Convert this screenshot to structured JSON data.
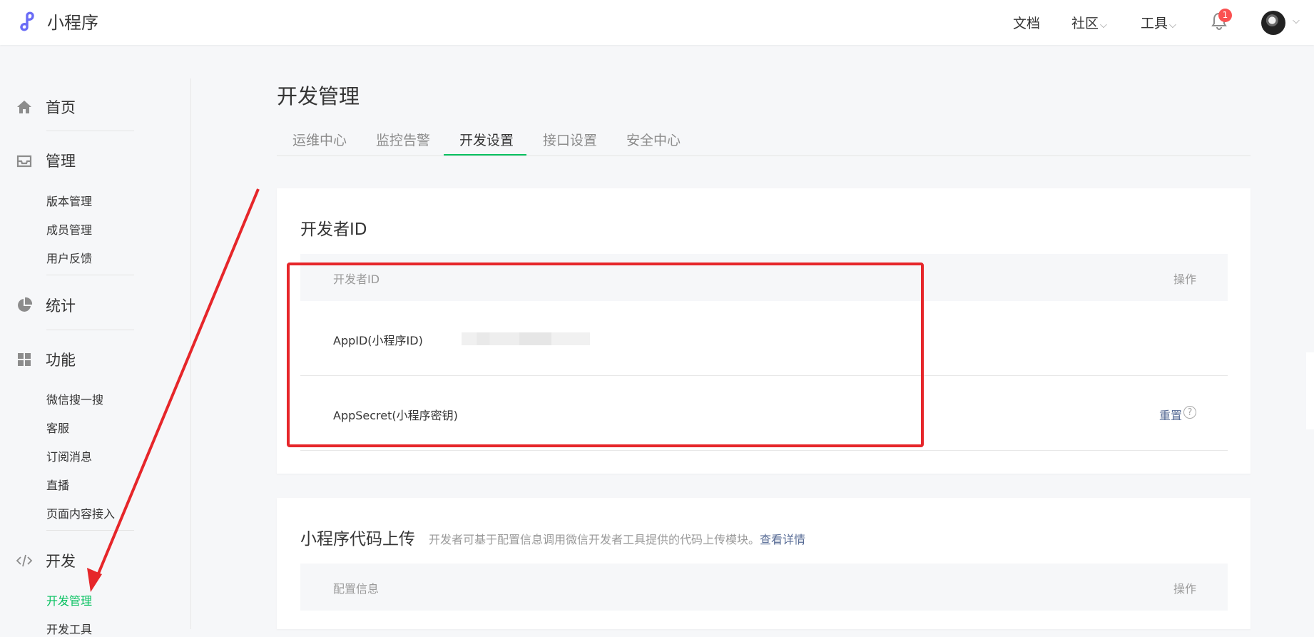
{
  "app": {
    "name": "小程序"
  },
  "topnav": {
    "docs": "文档",
    "community": "社区",
    "tools": "工具",
    "notification_count": "1"
  },
  "sidebar": {
    "home": "首页",
    "manage": {
      "label": "管理",
      "items": [
        "版本管理",
        "成员管理",
        "用户反馈"
      ]
    },
    "stats": "统计",
    "features": {
      "label": "功能",
      "items": [
        "微信搜一搜",
        "客服",
        "订阅消息",
        "直播",
        "页面内容接入"
      ]
    },
    "dev": {
      "label": "开发",
      "items": [
        "开发管理",
        "开发工具"
      ],
      "active": "开发管理"
    }
  },
  "main": {
    "title": "开发管理",
    "tabs": [
      "运维中心",
      "监控告警",
      "开发设置",
      "接口设置",
      "安全中心"
    ],
    "active_tab": "开发设置",
    "developer_id": {
      "title": "开发者ID",
      "col_name": "开发者ID",
      "col_action": "操作",
      "appid_label": "AppID(小程序ID)",
      "appsecret_label": "AppSecret(小程序密钥)",
      "reset": "重置",
      "help": "?"
    },
    "code_upload": {
      "title": "小程序代码上传",
      "desc": "开发者可基于配置信息调用微信开发者工具提供的代码上传模块。",
      "link": "查看详情",
      "col_config": "配置信息",
      "col_action": "操作"
    }
  },
  "colors": {
    "accent": "#07c160",
    "link": "#576b95",
    "annotation": "#e6262a",
    "badge": "#fa5151"
  }
}
